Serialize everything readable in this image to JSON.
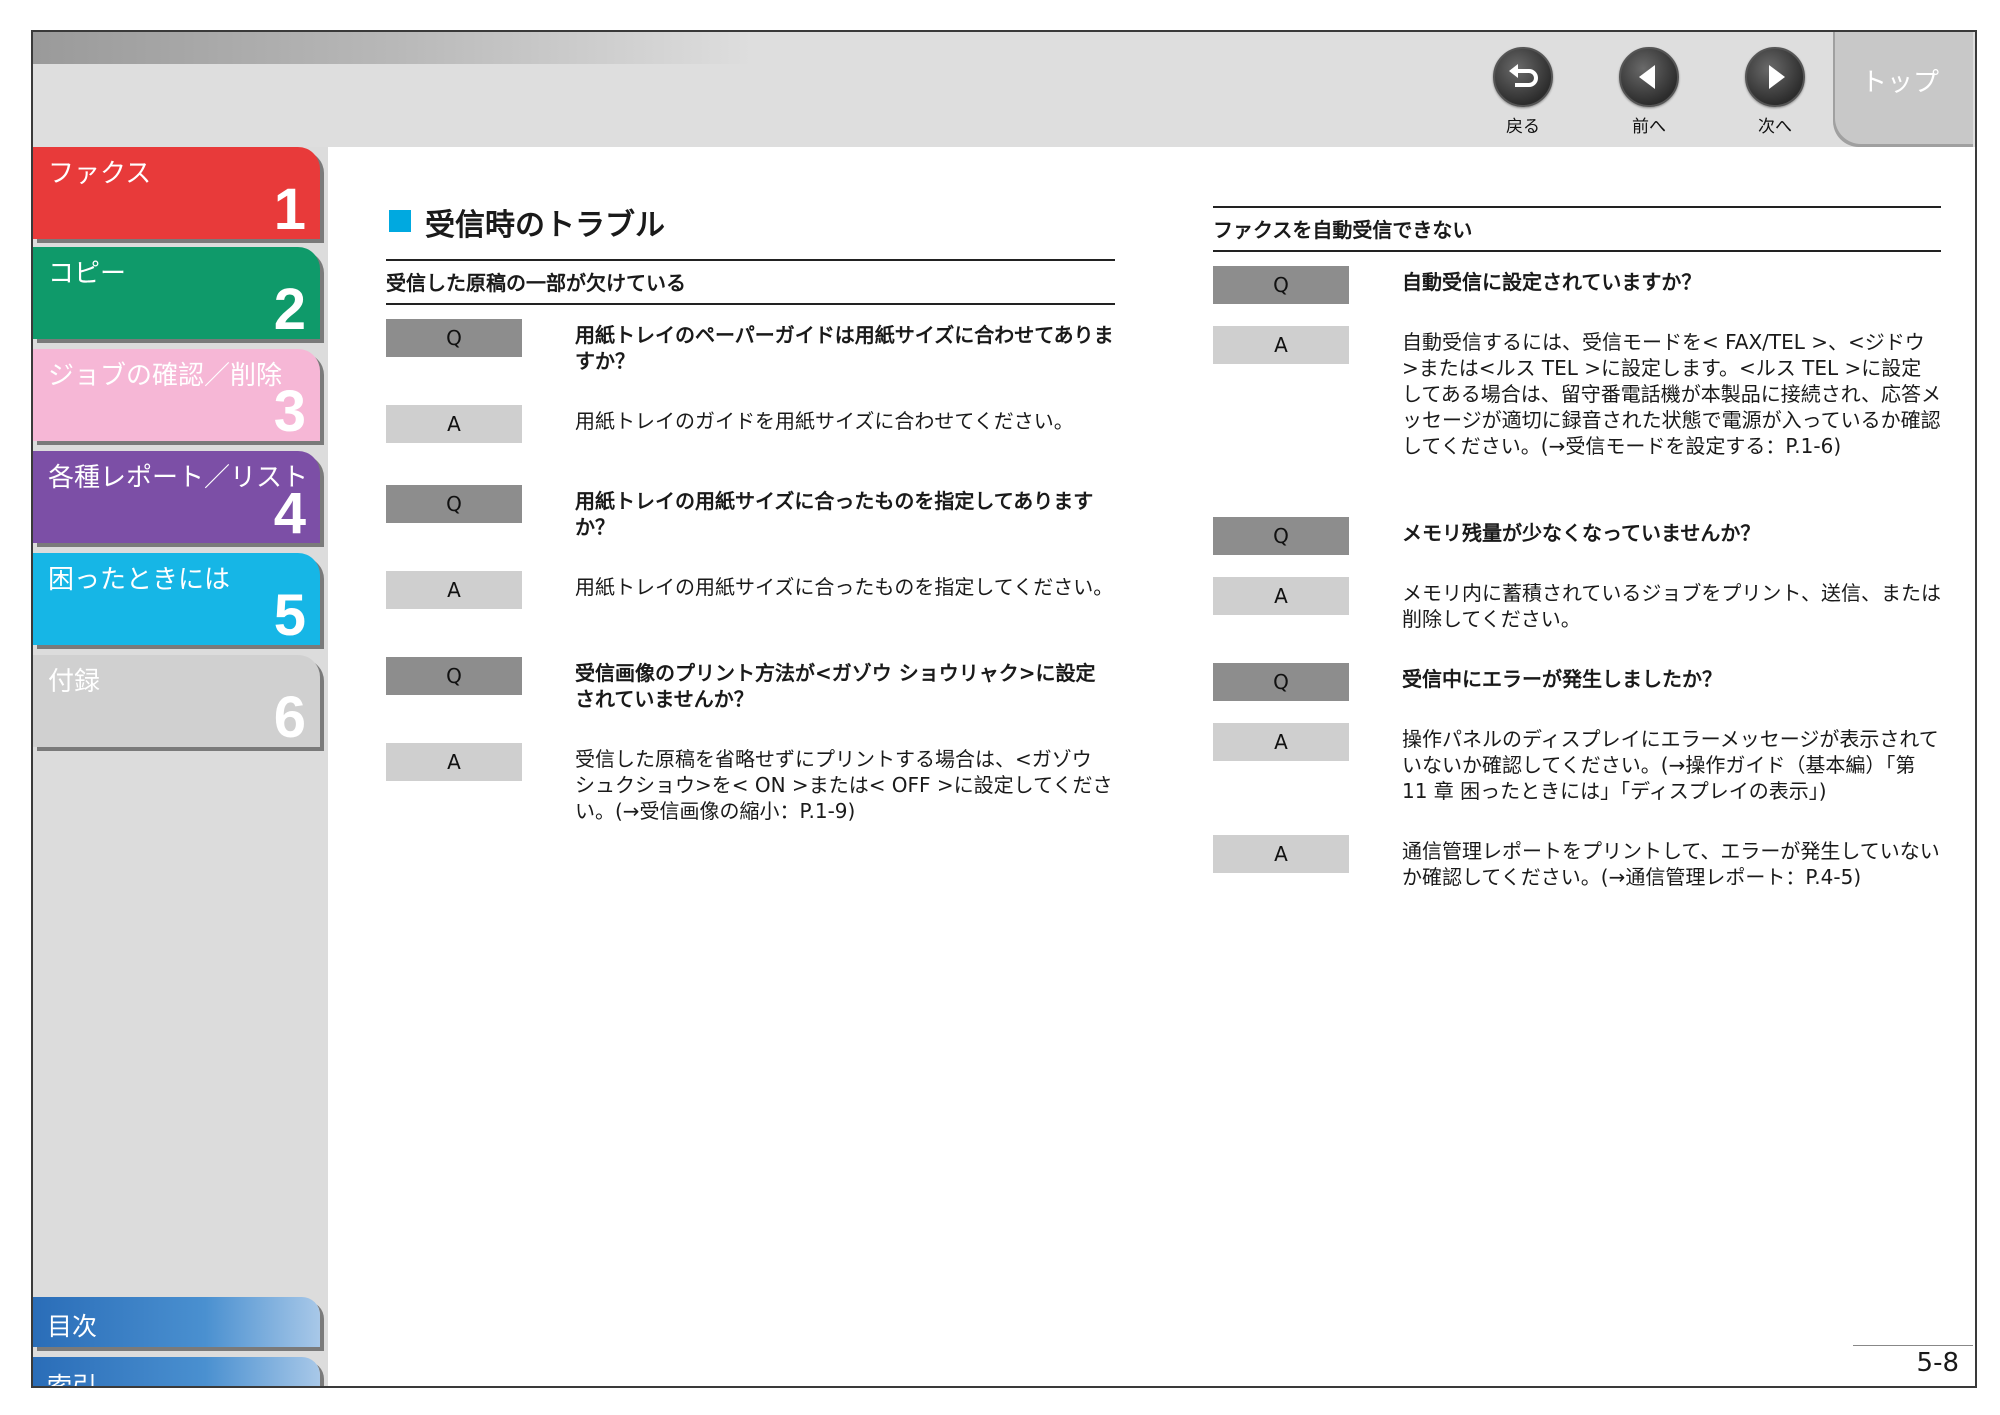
{
  "nav": {
    "back_label": "戻る",
    "prev_label": "前へ",
    "next_label": "次へ",
    "top_label": "トップ"
  },
  "sidebar": {
    "chapters": [
      {
        "name": "ファクス",
        "number": "1",
        "color": "#e83a3a"
      },
      {
        "name": "コピー",
        "number": "2",
        "color": "#0f9a6a"
      },
      {
        "name": "ジョブの確認／削除",
        "number": "3",
        "color": "#f6b7d6"
      },
      {
        "name": "各種レポート／リスト",
        "number": "4",
        "color": "#7c4fa6"
      },
      {
        "name": "困ったときには",
        "number": "5",
        "color": "#16b6e6"
      },
      {
        "name": "付録",
        "number": "6",
        "color": "#d0d0d0"
      }
    ],
    "toc_label": "目次",
    "index_label": "索引"
  },
  "main": {
    "title": "受信時のトラブル",
    "left": {
      "heading": "受信した原稿の一部が欠けている",
      "items": [
        {
          "label": "Q",
          "text": "用紙トレイのペーパーガイドは用紙サイズに合わせてありますか？"
        },
        {
          "label": "A",
          "text": "用紙トレイのガイドを用紙サイズに合わせてください。"
        },
        {
          "label": "Q",
          "text": "用紙トレイの用紙サイズに合ったものを指定してありますか？"
        },
        {
          "label": "A",
          "text": "用紙トレイの用紙サイズに合ったものを指定してください。"
        },
        {
          "label": "Q",
          "text": "受信画像のプリント方法が<ガゾウ ショウリャク>に設定されていませんか？"
        },
        {
          "label": "A",
          "text": "受信した原稿を省略せずにプリントする場合は、<ガゾウ シュクショウ>を< ON >または< OFF >に設定してください。(→受信画像の縮小：P.1-9)"
        }
      ]
    },
    "right": {
      "heading": "ファクスを自動受信できない",
      "items": [
        {
          "label": "Q",
          "text": "自動受信に設定されていますか？"
        },
        {
          "label": "A",
          "text": "自動受信するには、受信モードを< FAX/TEL >、<ジドウ>または<ルス TEL >に設定します。<ルス TEL >に設定してある場合は、留守番電話機が本製品に接続され、応答メッセージが適切に録音された状態で電源が入っているか確認してください。(→受信モードを設定する：P.1-6)"
        },
        {
          "label": "Q",
          "text": "メモリ残量が少なくなっていませんか？"
        },
        {
          "label": "A",
          "text": "メモリ内に蓄積されているジョブをプリント、送信、または削除してください。"
        },
        {
          "label": "Q",
          "text": "受信中にエラーが発生しましたか？"
        },
        {
          "label": "A",
          "text": "操作パネルのディスプレイにエラーメッセージが表示されていないか確認してください。(→操作ガイド（基本編）「第 11 章 困ったときには」「ディスプレイの表示」)"
        },
        {
          "label": "A",
          "text": "通信管理レポートをプリントして、エラーが発生していないか確認してください。(→通信管理レポート：P.4-5)"
        }
      ]
    }
  },
  "page_number": "5-8"
}
